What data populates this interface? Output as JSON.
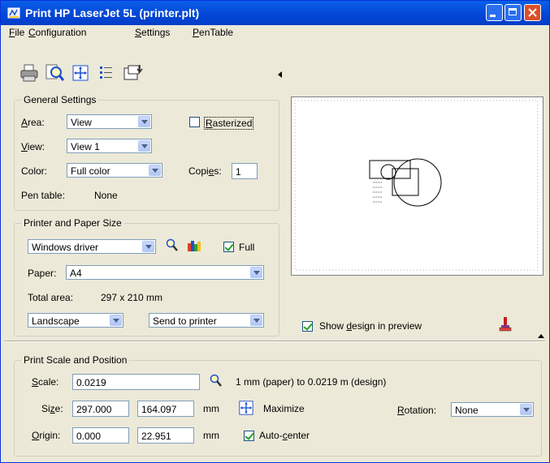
{
  "window": {
    "title": "Print  HP LaserJet 5L  (printer.plt)"
  },
  "menu": [
    {
      "key": "F",
      "rest": "ile"
    },
    {
      "key": "C",
      "rest": "onfiguration"
    },
    {
      "key": "S",
      "rest": "ettings"
    },
    {
      "key": "P",
      "rest": "enTable"
    }
  ],
  "toolbar": {
    "icons": [
      "printer-icon",
      "preview-zoom-icon",
      "fit-move-icon",
      "list-icon",
      "page-export-icon"
    ]
  },
  "general": {
    "title": "General Settings",
    "area_key": "A",
    "area_rest": "rea:",
    "area_value": "View",
    "rasterized_key": "R",
    "rasterized_rest": "asterized",
    "rasterized": false,
    "view_key": "V",
    "view_rest": "iew:",
    "view_value": "View 1",
    "color_label": "Color:",
    "color_value": "Full color",
    "copies_pre": "Copi",
    "copies_key": "e",
    "copies_post": "s:",
    "copies_value": "1",
    "pen_table_label": "Pen table:",
    "pen_table_value": "None"
  },
  "printer": {
    "title": "Printer and Paper Size",
    "driver_value": "Windows driver",
    "full_label": "Full",
    "full": true,
    "paper_label": "Paper:",
    "paper_value": "A4",
    "total_area_label": "Total area:",
    "total_area_value": "297 x 210 mm",
    "orientation_value": "Landscape",
    "output_value": "Send to printer"
  },
  "preview": {
    "show_pre": "Show ",
    "show_key": "d",
    "show_post": "esign in preview",
    "show": true
  },
  "scale_pos": {
    "title": "Print Scale and Position",
    "scale_key": "S",
    "scale_rest": "cale:",
    "scale_value": "0.0219",
    "scale_text": "1 mm (paper) to 0.0219 m (design)",
    "size_pre": "Si",
    "size_key": "z",
    "size_post": "e:",
    "size_w": "297.000",
    "size_h": "164.097",
    "size_unit": "mm",
    "maximize_label": "Maximize",
    "rotation_key": "R",
    "rotation_rest": "otation:",
    "rotation_value": "None",
    "origin_key": "O",
    "origin_rest": "rigin:",
    "origin_x": "0.000",
    "origin_y": "22.951",
    "origin_unit": "mm",
    "autocenter_pre": "Auto-",
    "autocenter_key": "c",
    "autocenter_post": "enter",
    "autocenter": true
  }
}
